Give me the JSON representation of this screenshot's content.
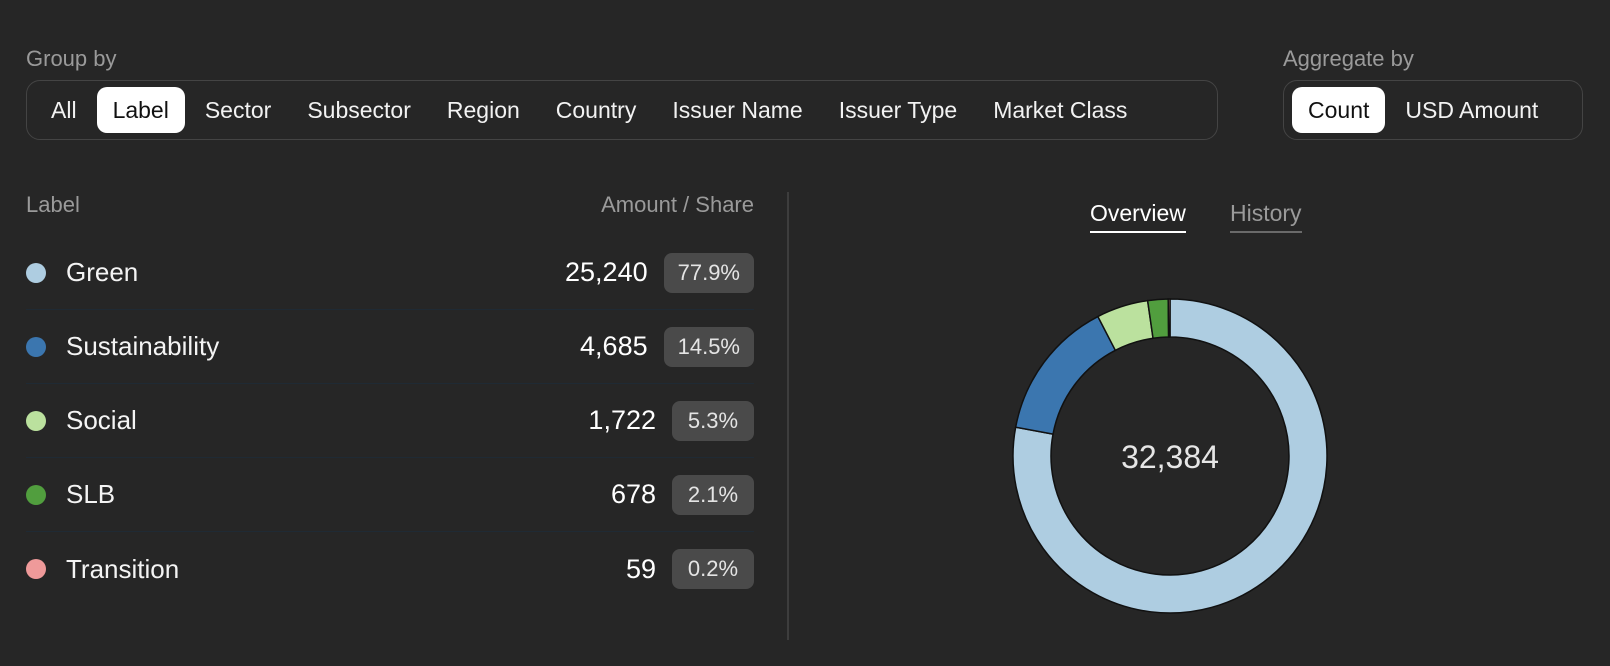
{
  "group_by": {
    "title": "Group by",
    "options": [
      "All",
      "Label",
      "Sector",
      "Subsector",
      "Region",
      "Country",
      "Issuer Name",
      "Issuer Type",
      "Market Class"
    ],
    "selected": "Label"
  },
  "aggregate_by": {
    "title": "Aggregate by",
    "options": [
      "Count",
      "USD Amount"
    ],
    "selected": "Count"
  },
  "table": {
    "col_label": "Label",
    "col_amount": "Amount / Share",
    "rows": [
      {
        "label": "Green",
        "amount": "25,240",
        "share": "77.9%",
        "color": "#aecde1"
      },
      {
        "label": "Sustainability",
        "amount": "4,685",
        "share": "14.5%",
        "color": "#3b76af"
      },
      {
        "label": "Social",
        "amount": "1,722",
        "share": "5.3%",
        "color": "#bbe19e"
      },
      {
        "label": "SLB",
        "amount": "678",
        "share": "2.1%",
        "color": "#519e3e"
      },
      {
        "label": "Transition",
        "amount": "59",
        "share": "0.2%",
        "color": "#ef9a9a"
      }
    ]
  },
  "tabs": {
    "overview": "Overview",
    "history": "History",
    "active": "Overview"
  },
  "chart_data": {
    "type": "pie",
    "categories": [
      "Green",
      "Sustainability",
      "Social",
      "SLB",
      "Transition"
    ],
    "values": [
      25240,
      4685,
      1722,
      678,
      59
    ],
    "colors": [
      "#aecde1",
      "#3b76af",
      "#bbe19e",
      "#519e3e",
      "#ef9a9a"
    ],
    "center_label": "32,384"
  }
}
